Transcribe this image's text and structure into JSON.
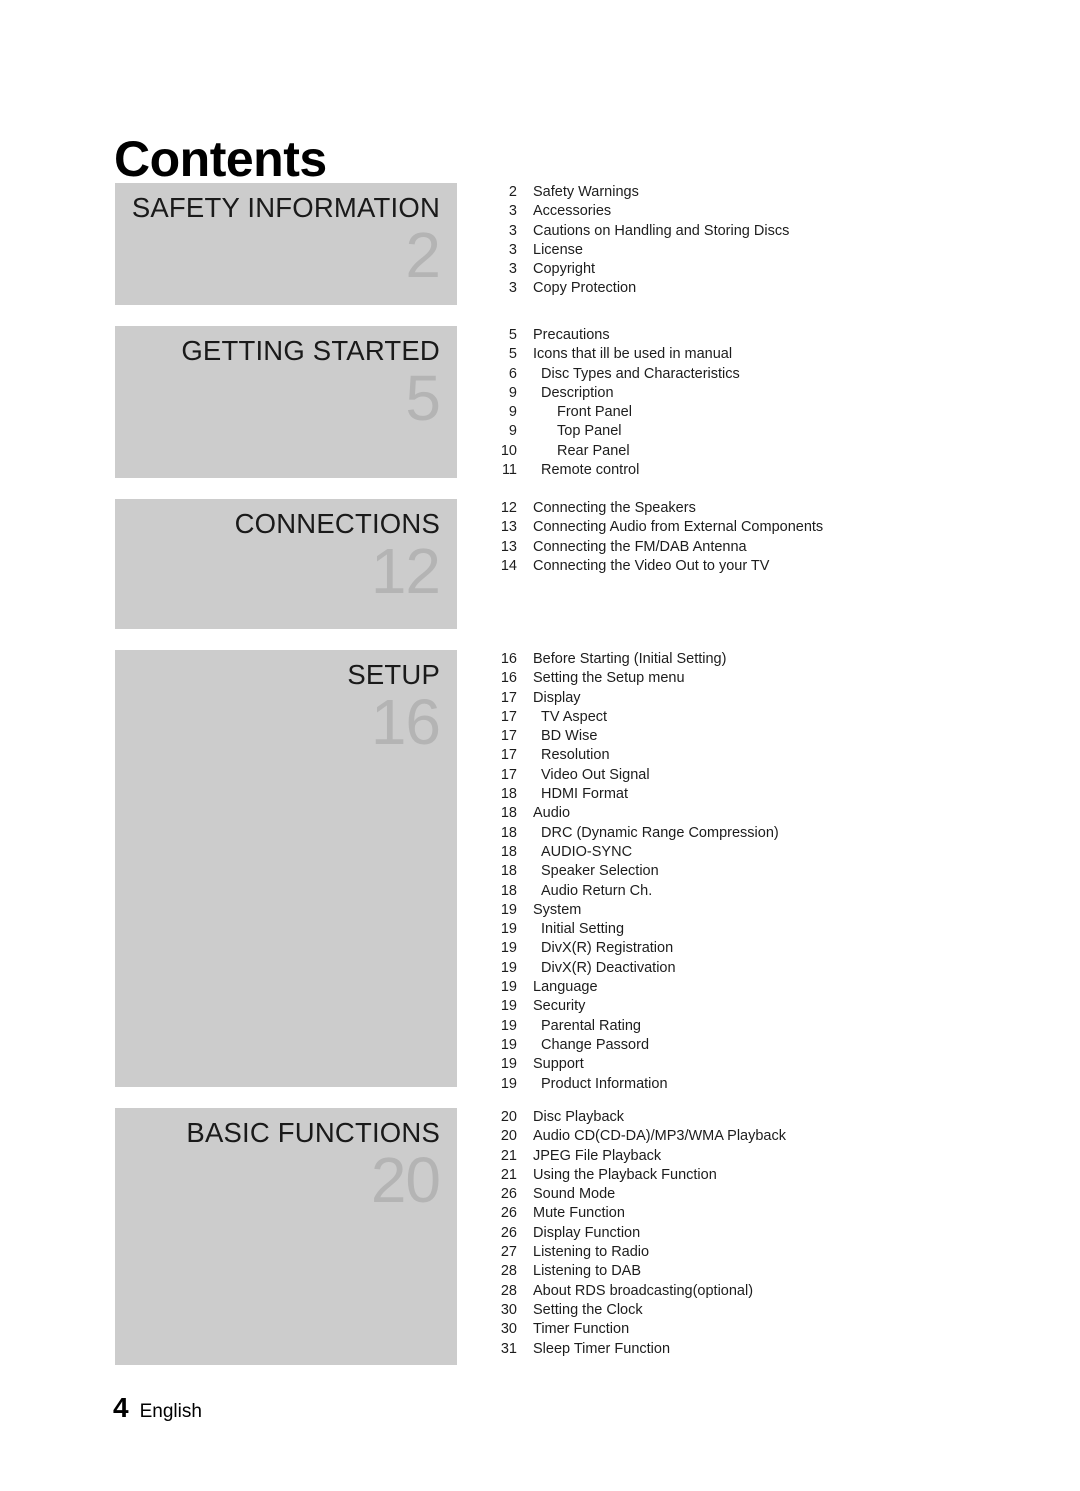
{
  "document": {
    "title": "Contents",
    "footer_page_number": "4",
    "footer_language": "English",
    "block_background_color": "#cccccc",
    "block_number_color": "#b4b4b4"
  },
  "sections": [
    {
      "title": "SAFETY INFORMATION",
      "number": "2",
      "block_height": 122,
      "entries": [
        {
          "page": "2",
          "label": "Safety Warnings",
          "level": 0
        },
        {
          "page": "3",
          "label": "Accessories",
          "level": 0
        },
        {
          "page": "3",
          "label": "Cautions on Handling and Storing Discs",
          "level": 0
        },
        {
          "page": "3",
          "label": "License",
          "level": 0
        },
        {
          "page": "3",
          "label": "Copyright",
          "level": 0
        },
        {
          "page": "3",
          "label": "Copy Protection",
          "level": 0
        }
      ]
    },
    {
      "title": "GETTING STARTED",
      "number": "5",
      "block_height": 152,
      "entries": [
        {
          "page": "5",
          "label": "Precautions",
          "level": 0
        },
        {
          "page": "5",
          "label": "Icons that ill be used in manual",
          "level": 0
        },
        {
          "page": "6",
          "label": "Disc Types and Characteristics",
          "level": 1
        },
        {
          "page": "9",
          "label": "Description",
          "level": 1
        },
        {
          "page": "9",
          "label": "Front Panel",
          "level": 2
        },
        {
          "page": "9",
          "label": "Top Panel",
          "level": 2
        },
        {
          "page": "10",
          "label": "Rear Panel",
          "level": 2
        },
        {
          "page": "11",
          "label": "Remote control",
          "level": 1
        }
      ]
    },
    {
      "title": "CONNECTIONS",
      "number": "12",
      "block_height": 130,
      "entries": [
        {
          "page": "12",
          "label": "Connecting the Speakers",
          "level": 0
        },
        {
          "page": "13",
          "label": "Connecting Audio from External Components",
          "level": 0
        },
        {
          "page": "13",
          "label": "Connecting the FM/DAB Antenna",
          "level": 0
        },
        {
          "page": "14",
          "label": "Connecting the Video Out to your TV",
          "level": 0
        }
      ]
    },
    {
      "title": "SETUP",
      "number": "16",
      "block_height": 437,
      "entries": [
        {
          "page": "16",
          "label": "Before Starting (Initial Setting)",
          "level": 0
        },
        {
          "page": "16",
          "label": "Setting the Setup menu",
          "level": 0
        },
        {
          "page": "17",
          "label": "Display",
          "level": 0
        },
        {
          "page": "17",
          "label": "TV Aspect",
          "level": 1
        },
        {
          "page": "17",
          "label": "BD Wise",
          "level": 1
        },
        {
          "page": "17",
          "label": "Resolution",
          "level": 1
        },
        {
          "page": "17",
          "label": "Video Out Signal",
          "level": 1
        },
        {
          "page": "18",
          "label": "HDMI Format",
          "level": 1
        },
        {
          "page": "18",
          "label": "Audio",
          "level": 0
        },
        {
          "page": "18",
          "label": "DRC (Dynamic Range Compression)",
          "level": 1
        },
        {
          "page": "18",
          "label": "AUDIO-SYNC",
          "level": 1
        },
        {
          "page": "18",
          "label": "Speaker Selection",
          "level": 1
        },
        {
          "page": "18",
          "label": "Audio Return Ch.",
          "level": 1
        },
        {
          "page": "19",
          "label": "System",
          "level": 0
        },
        {
          "page": "19",
          "label": "Initial Setting",
          "level": 1
        },
        {
          "page": "19",
          "label": "DivX(R) Registration",
          "level": 1
        },
        {
          "page": "19",
          "label": "DivX(R) Deactivation",
          "level": 1
        },
        {
          "page": "19",
          "label": "Language",
          "level": 0
        },
        {
          "page": "19",
          "label": "Security",
          "level": 0
        },
        {
          "page": "19",
          "label": "Parental Rating",
          "level": 1
        },
        {
          "page": "19",
          "label": "Change Passord",
          "level": 1
        },
        {
          "page": "19",
          "label": "Support",
          "level": 0
        },
        {
          "page": "19",
          "label": "Product Information",
          "level": 1
        }
      ]
    },
    {
      "title": "BASIC FUNCTIONS",
      "number": "20",
      "block_height": 257,
      "entries": [
        {
          "page": "20",
          "label": "Disc Playback",
          "level": 0
        },
        {
          "page": "20",
          "label": "Audio CD(CD-DA)/MP3/WMA Playback",
          "level": 0
        },
        {
          "page": "21",
          "label": "JPEG File Playback",
          "level": 0
        },
        {
          "page": "21",
          "label": "Using the Playback Function",
          "level": 0
        },
        {
          "page": "26",
          "label": "Sound Mode",
          "level": 0
        },
        {
          "page": "26",
          "label": "Mute Function",
          "level": 0
        },
        {
          "page": "26",
          "label": "Display Function",
          "level": 0
        },
        {
          "page": "27",
          "label": "Listening to Radio",
          "level": 0
        },
        {
          "page": "28",
          "label": "Listening to DAB",
          "level": 0
        },
        {
          "page": "28",
          "label": "About RDS broadcasting(optional)",
          "level": 0
        },
        {
          "page": "30",
          "label": "Setting the Clock",
          "level": 0
        },
        {
          "page": "30",
          "label": "Timer Function",
          "level": 0
        },
        {
          "page": "31",
          "label": "Sleep Timer Function",
          "level": 0
        }
      ]
    }
  ]
}
